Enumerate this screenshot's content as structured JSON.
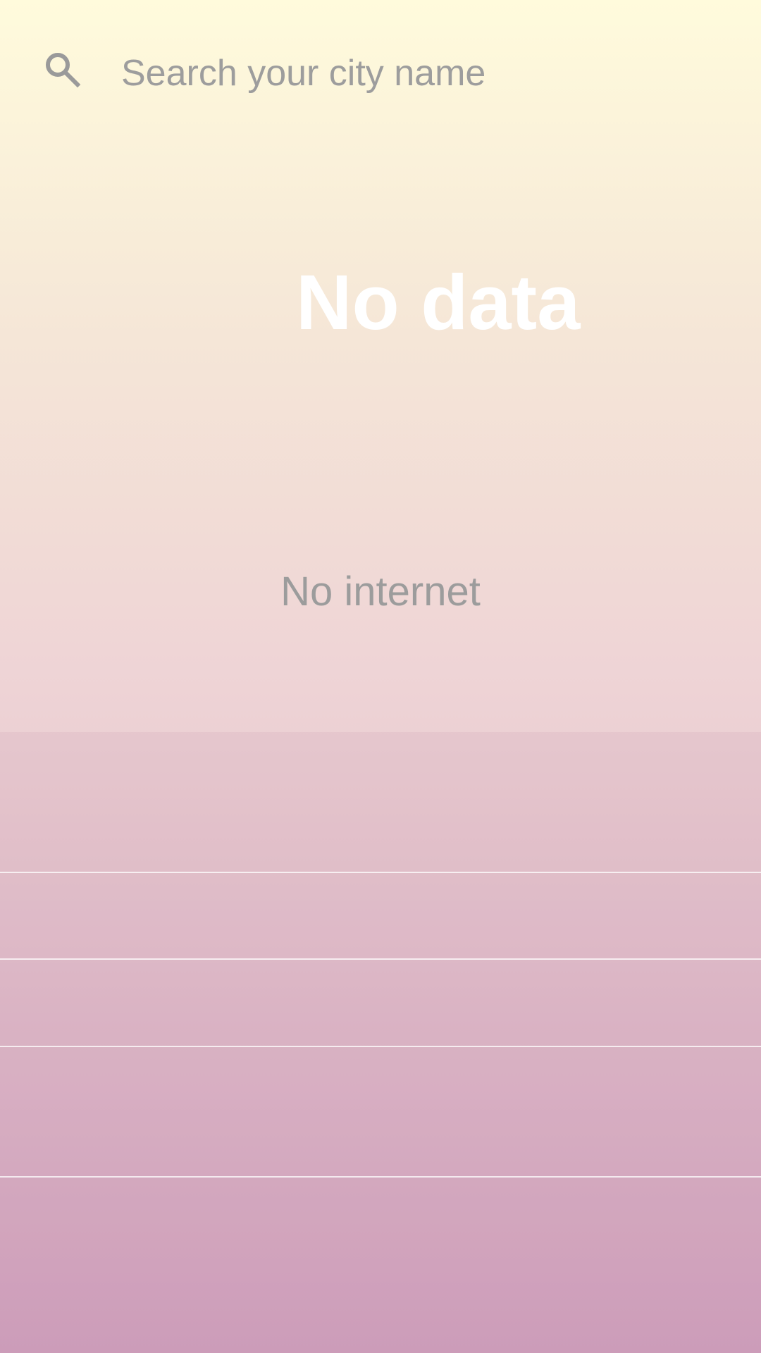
{
  "search": {
    "placeholder": "Search your city name",
    "value": "",
    "icon": "search-icon"
  },
  "headline": "No data",
  "status": "No internet",
  "colors": {
    "gradient_top": "#fffbdc",
    "gradient_mid": "#efd5d6",
    "gradient_bottom": "#cf9fbd",
    "headline": "#ffffff",
    "muted_text": "#9c9c9c",
    "divider": "#ffffff"
  }
}
